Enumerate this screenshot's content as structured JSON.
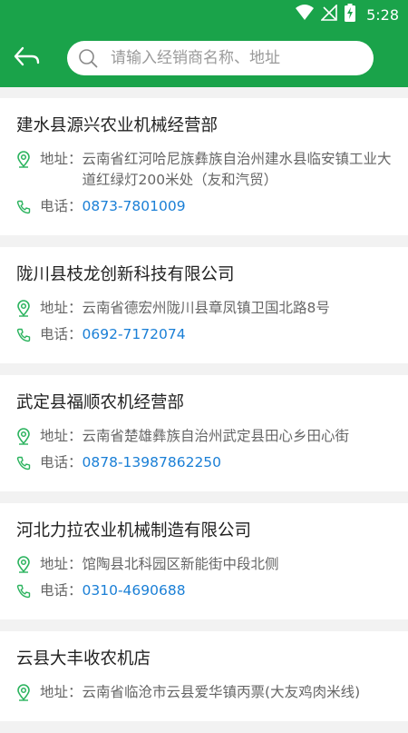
{
  "status_bar": {
    "time": "5:28"
  },
  "search": {
    "placeholder": "请输入经销商名称、地址"
  },
  "labels": {
    "address": "地址：",
    "phone": "电话："
  },
  "dealers": [
    {
      "name": "建水县源兴农业机械经营部",
      "address": "云南省红河哈尼族彝族自治州建水县临安镇工业大道红绿灯200米处（友和汽贸）",
      "phone": "0873-7801009"
    },
    {
      "name": "陇川县枝龙创新科技有限公司",
      "address": "云南省德宏州陇川县章凤镇卫国北路8号",
      "phone": "0692-7172074"
    },
    {
      "name": "武定县福顺农机经营部",
      "address": "云南省楚雄彝族自治州武定县田心乡田心街",
      "phone": "0878-13987862250"
    },
    {
      "name": "河北力拉农业机械制造有限公司",
      "address": "馆陶县北科园区新能街中段北侧",
      "phone": "0310-4690688"
    },
    {
      "name": "云县大丰收农机店",
      "address": "云南省临沧市云县爱华镇丙票(大友鸡肉米线)"
    }
  ],
  "colors": {
    "primary": "#1aa34a",
    "phone_link": "#1a7fd6",
    "icon_green": "#2bb35e"
  }
}
